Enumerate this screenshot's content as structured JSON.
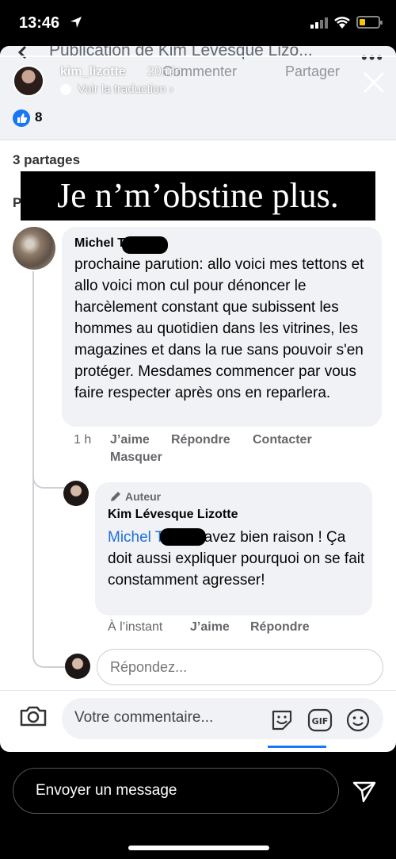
{
  "status_bar": {
    "time": "13:46"
  },
  "post_header": {
    "title": "Publication de Kim Lévesque Lizo...",
    "comment_ghost": "Commenter",
    "share_ghost": "Partager"
  },
  "story": {
    "username": "kim_lizotte",
    "time": "20min",
    "translate": "Voir la traduction",
    "caption": "Je n’m’obstine plus."
  },
  "post_stats": {
    "likes": "8",
    "shares": "3 partages",
    "partial_label": "P"
  },
  "comment": {
    "author": "Michel T",
    "text": "prochaine parution: allo voici mes tettons et allo voici mon cul pour dénoncer le harcèlement constant que subissent les hommes au quotidien dans les vitrines, les magazines et dans la rue sans pouvoir s'en protéger. Mesdames commencer par vous faire respecter après ons en reparlera.",
    "time": "1 h",
    "actions": [
      "J’aime",
      "Répondre",
      "Contacter",
      "Masquer"
    ]
  },
  "reply": {
    "badge": "Auteur",
    "author": "Kim Lévesque Lizotte",
    "mention": "Michel T",
    "text": " vous avez bien raison ! Ça doit aussi expliquer pourquoi on se fait constamment agresser!",
    "time": "À l’instant",
    "actions": [
      "J’aime",
      "Répondre"
    ]
  },
  "reply_input": {
    "placeholder": "Répondez..."
  },
  "comment_bar": {
    "placeholder": "Votre commentaire..."
  },
  "story_reply": {
    "placeholder": "Envoyer un message"
  },
  "colors": {
    "facebook_blue": "#1877f2",
    "mention": "#216fdb",
    "bubble": "#f0f2f5"
  }
}
